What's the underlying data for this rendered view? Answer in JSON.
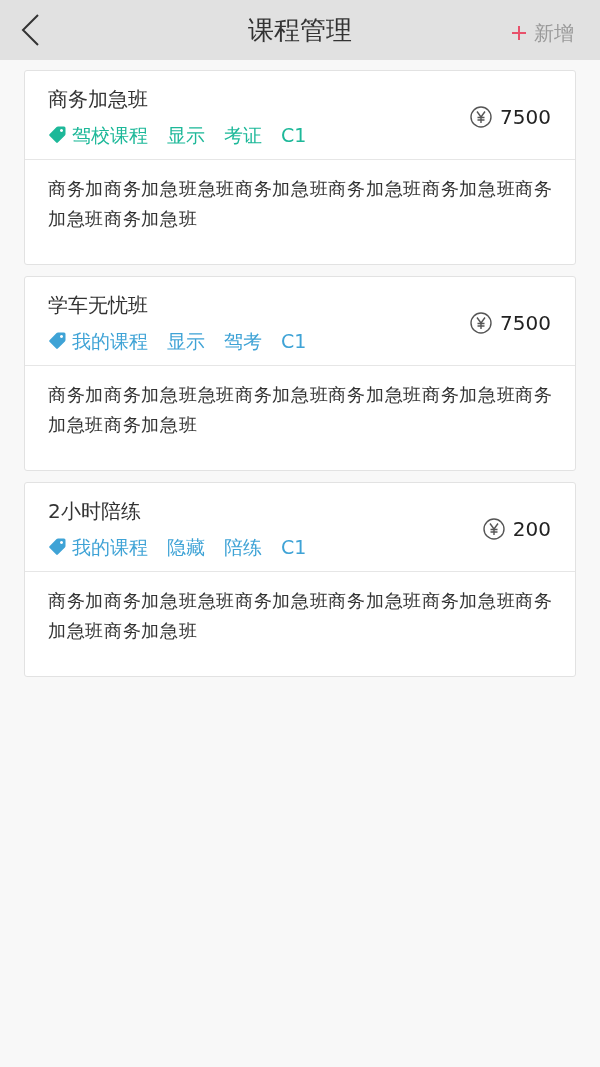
{
  "header": {
    "title": "课程管理",
    "add_label": "新增"
  },
  "courses": [
    {
      "title": "商务加急班",
      "color": "#1db899",
      "tags": [
        "驾校课程",
        "显示",
        "考证",
        "C1"
      ],
      "price": "7500",
      "description": "商务加商务加急班急班商务加急班商务加急班商务加急班商务加急班商务加急班"
    },
    {
      "title": "学车无忧班",
      "color": "#3fa3d6",
      "tags": [
        "我的课程",
        "显示",
        "驾考",
        "C1"
      ],
      "price": "7500",
      "description": "商务加商务加急班急班商务加急班商务加急班商务加急班商务加急班商务加急班"
    },
    {
      "title": "2小时陪练",
      "color": "#3fa3d6",
      "tags": [
        "我的课程",
        "隐藏",
        "陪练",
        "C1"
      ],
      "price": "200",
      "description": "商务加商务加急班急班商务加急班商务加急班商务加急班商务加急班商务加急班"
    }
  ]
}
